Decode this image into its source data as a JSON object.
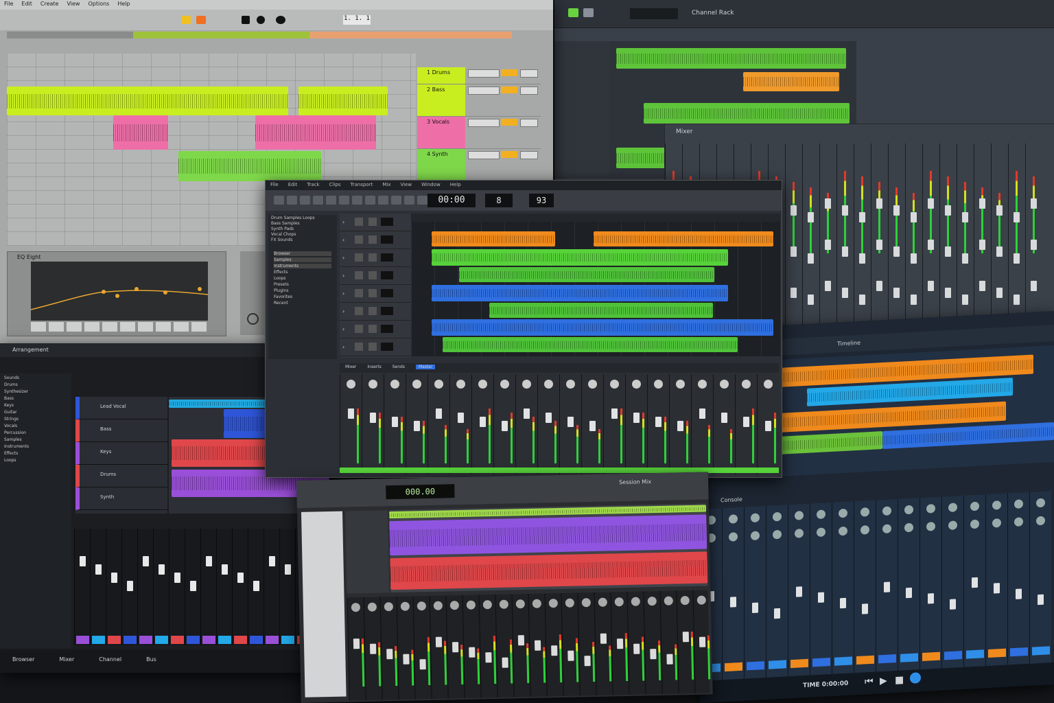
{
  "w1": {
    "menu": [
      "File",
      "Edit",
      "Create",
      "View",
      "Options",
      "Help"
    ],
    "transport_display": "1. 1. 1",
    "tracks": [
      {
        "name": "1 Drums",
        "color": "#c8ee20"
      },
      {
        "name": "2 Bass",
        "color": "#c8ee20"
      },
      {
        "name": "3 Vocals",
        "color": "#ee6fa8"
      },
      {
        "name": "4 Synth",
        "color": "#7fd84a"
      }
    ],
    "device_title": "EQ Eight"
  },
  "w2": {
    "channel_label": "Channel Rack",
    "mixer_title": "Mixer"
  },
  "w3": {
    "menu": [
      "File",
      "Edit",
      "Track",
      "Clips",
      "Transport",
      "Mix",
      "View",
      "Window",
      "Help"
    ],
    "time_display": "00:00",
    "bars_display": "8",
    "bpm_display": "93",
    "browser_items": [
      "Drum Samples Loops",
      "Bass Samples",
      "Synth Pads",
      "Vocal Chops",
      "FX Sounds"
    ],
    "browser_tree": [
      "Browser",
      "Samples",
      "Instruments",
      "Effects",
      "Loops",
      "Presets",
      "Plugins",
      "Favorites",
      "Recent"
    ],
    "mixer_tabs": [
      "Mixer",
      "Inserts",
      "Sends",
      "Master"
    ]
  },
  "w4": {
    "title": "Arrangement",
    "tracks": [
      "Lead Vocal",
      "Bass",
      "Keys",
      "Drums",
      "Synth"
    ],
    "browser": [
      "Sounds",
      "Drums",
      "Synthesizer",
      "Bass",
      "Keys",
      "Guitar",
      "Strings",
      "Vocals",
      "Percussion",
      "Samples",
      "Instruments",
      "Effects",
      "Loops"
    ],
    "footer": [
      "Browser",
      "Mixer",
      "Channel",
      "Bus"
    ]
  },
  "w5": {
    "lcd": "000.00",
    "title": "Session Mix"
  },
  "w6": {
    "tab": "Timeline",
    "mixer_title": "Console",
    "footer_text": "TIME 0:00:00"
  },
  "colors": {
    "orange": "#f08a1c",
    "green": "#4fc23a",
    "blue": "#2f6fe0",
    "lime": "#c8ee20",
    "pink": "#ee6fa8",
    "purple": "#9a4fd8",
    "red": "#e0474a"
  }
}
